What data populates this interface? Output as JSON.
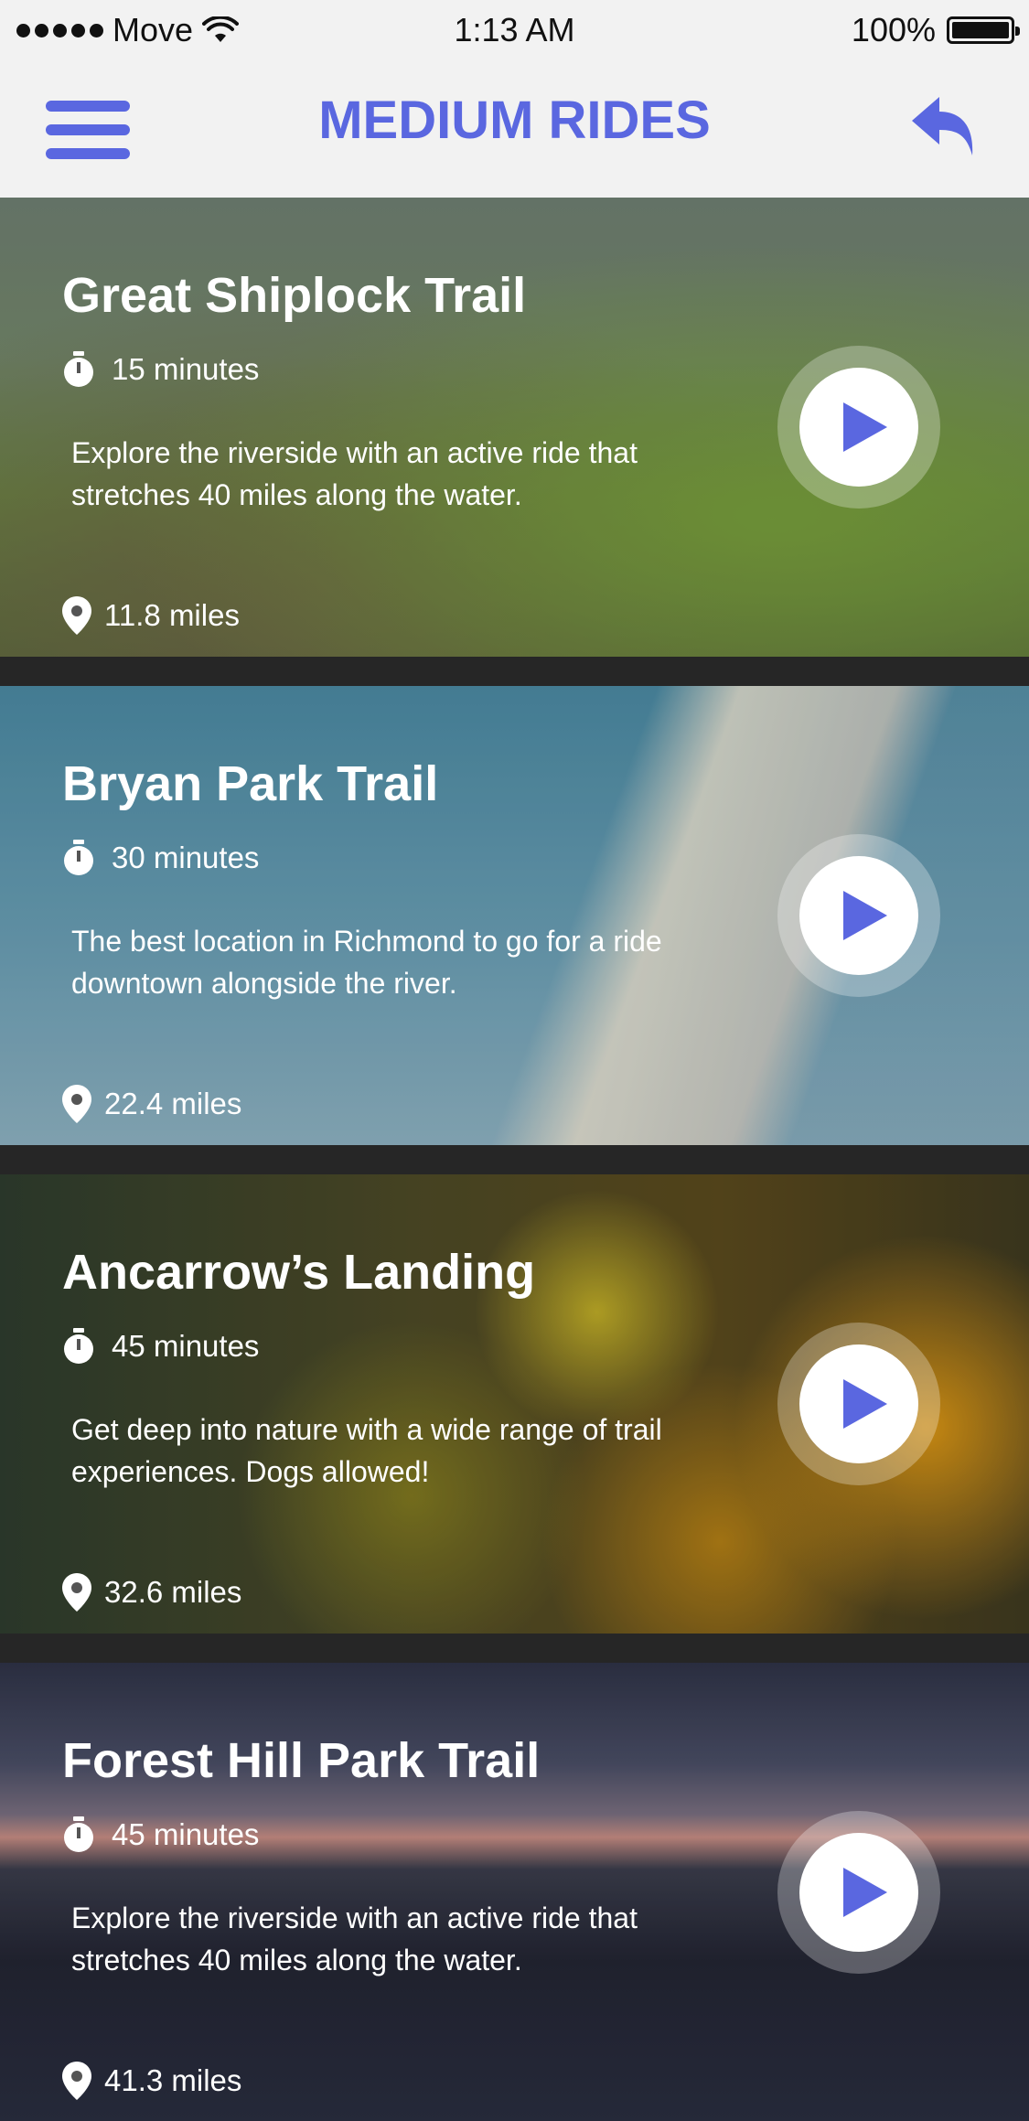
{
  "status_bar": {
    "carrier": "Move",
    "time": "1:13 AM",
    "battery": "100%"
  },
  "nav": {
    "title": "MEDIUM RIDES",
    "menu_icon": "hamburger-menu-icon",
    "back_icon": "reply-back-icon"
  },
  "colors": {
    "accent": "#5a67e0",
    "nav_background": "#f2f2f2",
    "text_on_image": "#ffffff"
  },
  "rides": [
    {
      "title": "Great Shiplock Trail",
      "duration": "15 minutes",
      "description": "Explore the riverside with an active ride that stretches 40 miles along the water.",
      "distance": "11.8 miles"
    },
    {
      "title": "Bryan Park Trail",
      "duration": "30 minutes",
      "description": "The best location in Richmond to go for a ride downtown alongside the river.",
      "distance": "22.4 miles"
    },
    {
      "title": "Ancarrow’s Landing",
      "duration": "45 minutes",
      "description": "Get deep into nature with a wide range of trail experiences. Dogs allowed!",
      "distance": "32.6 miles"
    },
    {
      "title": "Forest Hill Park Trail",
      "duration": "45 minutes",
      "description": "Explore the riverside with an active ride that stretches 40 miles along the water.",
      "distance": "41.3 miles"
    }
  ]
}
